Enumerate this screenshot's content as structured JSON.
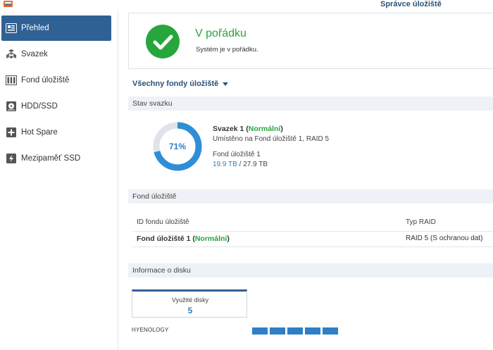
{
  "window": {
    "title": "Správce úložiště"
  },
  "sidebar": {
    "items": [
      {
        "label": "Přehled",
        "icon": "overview-icon"
      },
      {
        "label": "Svazek",
        "icon": "volume-icon"
      },
      {
        "label": "Fond úložiště",
        "icon": "storage-pool-icon"
      },
      {
        "label": "HDD/SSD",
        "icon": "hdd-icon"
      },
      {
        "label": "Hot Spare",
        "icon": "hot-spare-icon"
      },
      {
        "label": "Mezipaměť SSD",
        "icon": "ssd-cache-icon"
      }
    ],
    "active_index": 0
  },
  "status": {
    "title": "V pořádku",
    "subtitle": "Systém je v pořádku.",
    "icon": "check-icon",
    "color": "#26a63d"
  },
  "pool_selector": {
    "label": "Všechny fondy úložiště"
  },
  "volume_section": {
    "heading": "Stav svazku",
    "usage_percent": 71,
    "usage_label": "71%",
    "name": "Svazek 1",
    "state": "Normální",
    "location": "Umístěno na Fond úložiště 1, RAID 5",
    "pool": "Fond úložiště 1",
    "used": "19.9 TB",
    "separator": " / ",
    "total": "27.9 TB"
  },
  "pool_section": {
    "heading": "Fond úložiště",
    "columns": [
      "ID fondu úložiště",
      "Typ RAID"
    ],
    "rows": [
      {
        "id": "Fond úložiště 1",
        "state": "Normální",
        "raid": "RAID 5 (S ochranou dat)"
      }
    ]
  },
  "disk_section": {
    "heading": "Informace o disku",
    "used_label": "Využité disky",
    "used_value": "5",
    "brand": "HYENOLOGY",
    "bay_count": 5
  },
  "colors": {
    "accent": "#2f6195",
    "ok": "#26a63d",
    "link": "#2f7fc5"
  }
}
